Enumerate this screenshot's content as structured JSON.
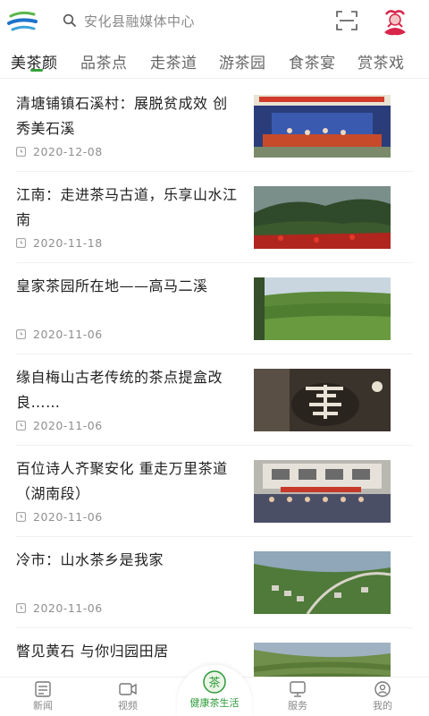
{
  "header": {
    "search_placeholder": "安化县融媒体中心"
  },
  "tabs": [
    {
      "label": "美茶颜",
      "active": true
    },
    {
      "label": "品茶点",
      "active": false
    },
    {
      "label": "走茶道",
      "active": false
    },
    {
      "label": "游茶园",
      "active": false
    },
    {
      "label": "食茶宴",
      "active": false
    },
    {
      "label": "赏茶戏",
      "active": false
    }
  ],
  "articles": [
    {
      "title": "清塘铺镇石溪村：展脱贫成效 创秀美石溪",
      "date": "2020-12-08"
    },
    {
      "title": "江南：走进茶马古道，乐享山水江南",
      "date": "2020-11-18"
    },
    {
      "title": "皇家茶园所在地——高马二溪",
      "date": "2020-11-06"
    },
    {
      "title": "缘自梅山古老传统的茶点提盒改良……",
      "date": "2020-11-06"
    },
    {
      "title": "百位诗人齐聚安化  重走万里茶道（湖南段）",
      "date": "2020-11-06"
    },
    {
      "title": "冷市：山水茶乡是我家",
      "date": "2020-11-06"
    },
    {
      "title": "瞥见黄石  与你归园田居",
      "date": ""
    }
  ],
  "bottom_nav": {
    "news": "新闻",
    "video": "视频",
    "center": "健康茶生活",
    "service": "服务",
    "mine": "我的",
    "center_icon_text": "茶"
  },
  "colors": {
    "accent": "#33a13a",
    "logo_blue": "#1e73c8",
    "logo_green": "#5bb74a",
    "avatar_red": "#d8264b"
  }
}
